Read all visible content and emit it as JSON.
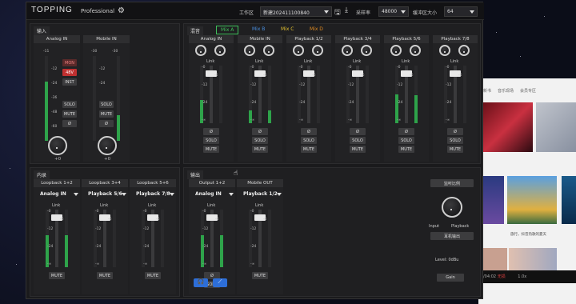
{
  "title": {
    "logo": "TOPPING",
    "subtitle": "Professional",
    "workspace_label": "工作区",
    "workspace_value": "新建202411100840",
    "samplerate_label": "采样率",
    "samplerate_value": "48000",
    "buffer_label": "缓冲区大小",
    "buffer_value": "64"
  },
  "input": {
    "section": "输入",
    "channels": [
      {
        "name": "Analog IN",
        "top": "-11",
        "gain": "+0"
      },
      {
        "name": "Mobile IN",
        "top": "-30",
        "gain": "+0"
      }
    ],
    "buttons": {
      "mon": "MON",
      "v48": "48V",
      "inst": "INST",
      "solo": "SOLO",
      "mute": "MUTE",
      "phase": "Ø"
    }
  },
  "mixer": {
    "section": "混音",
    "tabs": [
      "Mix A",
      "Mix B",
      "Mix C",
      "Mix D"
    ],
    "tab_colors": [
      "#3fbf5a",
      "#4a8fe0",
      "#e0c030",
      "#e08a20"
    ],
    "channels": [
      "Analog IN",
      "Mobile IN",
      "Playback 1/2",
      "Playback 3/4",
      "Playback 5/6",
      "Playback 7/8"
    ]
  },
  "loopback": {
    "section": "内录",
    "channels": [
      {
        "name": "Loopback 1+2",
        "source": "Analog IN"
      },
      {
        "name": "Loopback 3+4",
        "source": "Playback 5/6"
      },
      {
        "name": "Loopback 5+6",
        "source": "Playback 7/8"
      }
    ]
  },
  "output": {
    "section": "输出",
    "channels": [
      {
        "name": "Output 1+2",
        "source": "Analog IN"
      },
      {
        "name": "Mobile OUT",
        "source": "Playback 1/2"
      }
    ]
  },
  "monitor": {
    "title": "监听比例",
    "input": "Input",
    "playback": "Playback",
    "headphone_title": "耳机输出",
    "level": "Level: 0dBu",
    "gain": "Gain"
  },
  "common": {
    "link": "Link",
    "solo": "SOLO",
    "mute": "MUTE",
    "phase": "Ø",
    "db0": "-0",
    "db6": "-6",
    "db12": "-12",
    "db24": "-24",
    "db36": "-36",
    "db48": "-48",
    "db60": "-60",
    "dbinf": "-∞"
  },
  "bg": {
    "tabs": [
      "新书",
      "音乐现场",
      "会员专区"
    ],
    "cap": "旅行，抖音热歌的夏天",
    "time": "/04:02",
    "quality": "无损",
    "speed": "1.0x"
  }
}
